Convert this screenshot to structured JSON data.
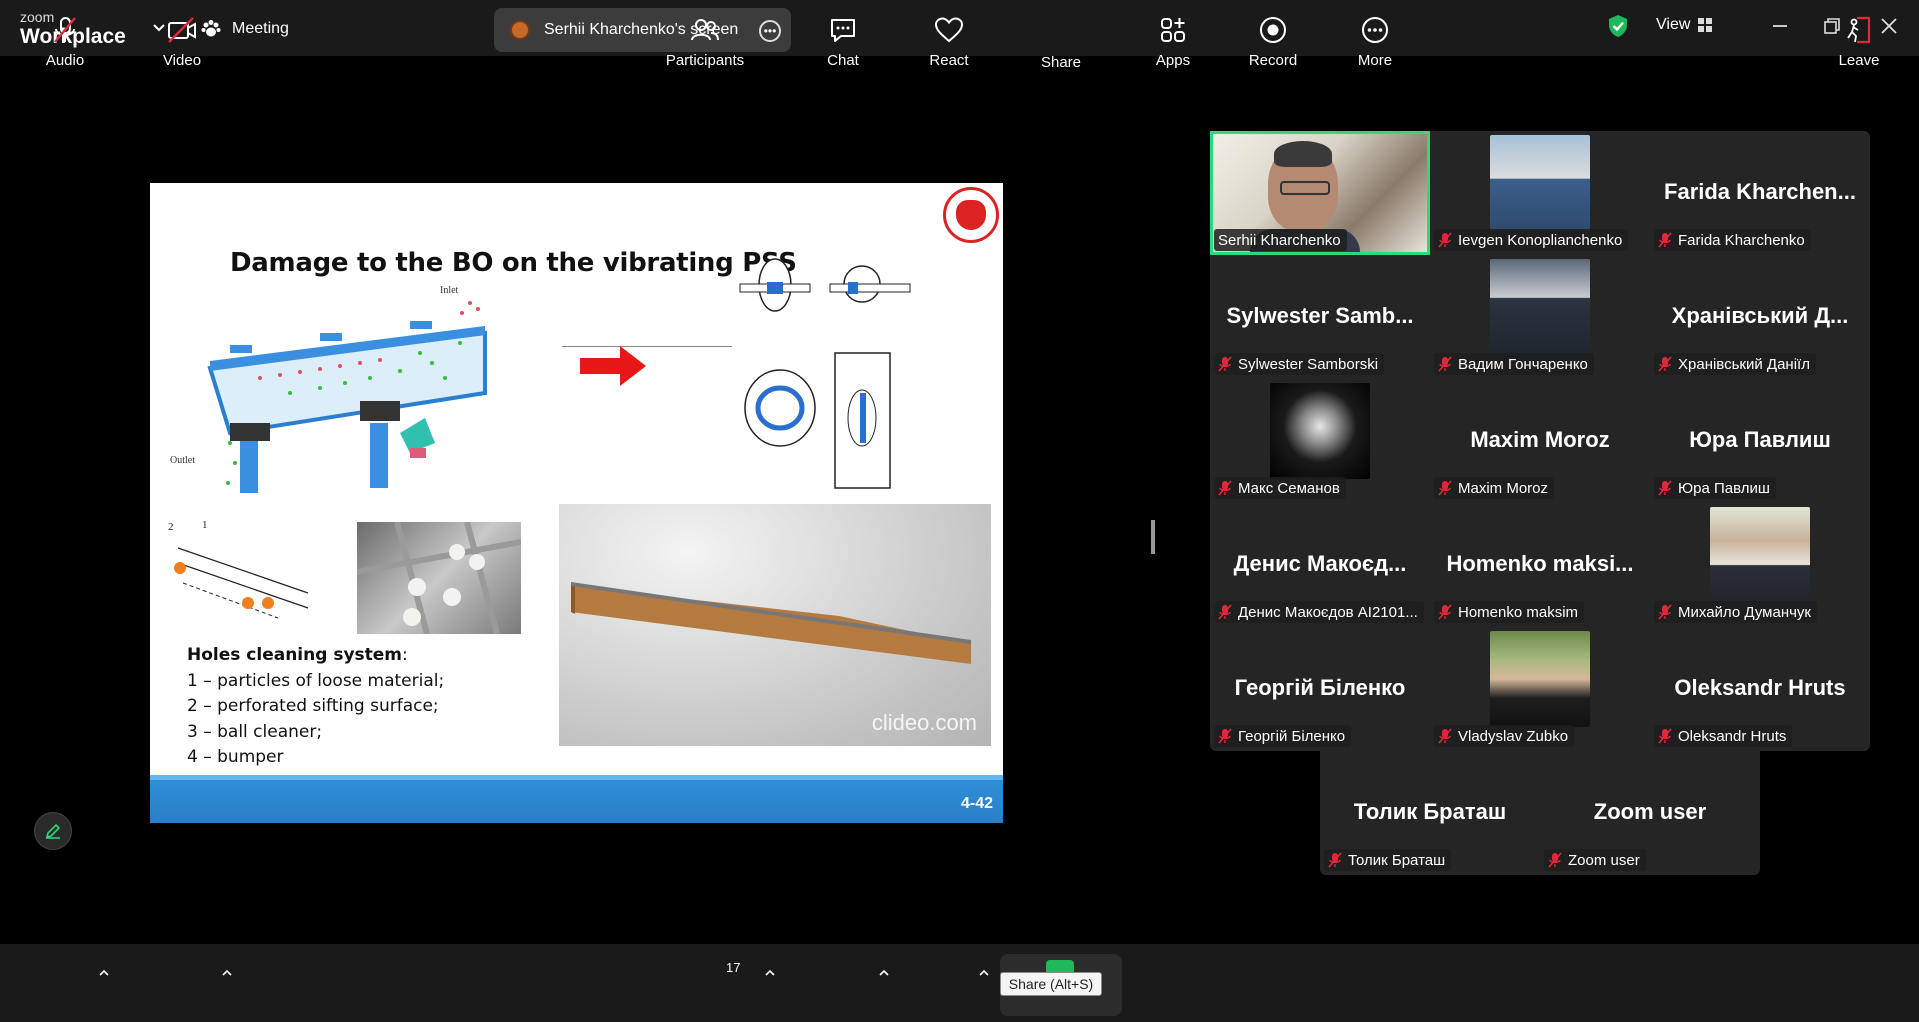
{
  "app": {
    "logo_top": "zoom",
    "logo_bottom": "Workplace"
  },
  "header": {
    "meeting_label": "Meeting",
    "screen_share_label": "Serhii Kharchenko's screen",
    "view_label": "View"
  },
  "slide": {
    "title": "Damage to the BO on the vibrating PSS",
    "inlet_label": "Inlet",
    "outlet_label": "Outlet",
    "holes_heading": "Holes cleaning system",
    "holes_colon": ":",
    "holes_items": [
      "1 – particles of loose material;",
      "2 – perforated sifting surface;",
      "3 – ball cleaner;",
      "4 – bumper"
    ],
    "video_watermark": "clideo.com",
    "page_number": "4-42"
  },
  "gallery": {
    "participants": [
      {
        "name": "Serhii Kharchenko",
        "big": "",
        "photo": true,
        "active": true,
        "muted": false
      },
      {
        "name": "Ievgen Konoplianchenko",
        "big": "",
        "photo": true,
        "muted": true
      },
      {
        "name": "Farida Kharchenko",
        "big": "Farida  Kharchen...",
        "muted": true
      },
      {
        "name": "Sylwester Samborski",
        "big": "Sylwester  Samb...",
        "muted": true
      },
      {
        "name": "Вадим Гончаренко",
        "big": "",
        "photo": true,
        "muted": true
      },
      {
        "name": "Хранівський Даніїл",
        "big": "Хранівський  Д...",
        "muted": true
      },
      {
        "name": "Макс Семанов",
        "big": "",
        "photo": true,
        "muted": true
      },
      {
        "name": "Maxim Moroz",
        "big": "Maxim Moroz",
        "muted": true
      },
      {
        "name": "Юра Павлиш",
        "big": "Юра Павлиш",
        "muted": true
      },
      {
        "name": "Денис Макоєдов АІ2101...",
        "big": "Денис  Макоєд...",
        "muted": true
      },
      {
        "name": "Homenko maksim",
        "big": "Homenko  maksi...",
        "muted": true
      },
      {
        "name": "Михайло Думанчук",
        "big": "",
        "photo": true,
        "muted": true
      },
      {
        "name": "Георгій Біленко",
        "big": "Георгій Біленко",
        "muted": true
      },
      {
        "name": "Vladyslav Zubko",
        "big": "",
        "photo": true,
        "muted": true
      },
      {
        "name": "Oleksandr Hruts",
        "big": "Oleksandr Hruts",
        "muted": true
      },
      {
        "name": "Толик Браташ",
        "big": "Толик Браташ",
        "muted": true
      },
      {
        "name": "Zoom user",
        "big": "Zoom user",
        "muted": true
      }
    ]
  },
  "toolbar": {
    "audio": "Audio",
    "video": "Video",
    "participants": "Participants",
    "participants_count": "17",
    "chat": "Chat",
    "react": "React",
    "share": "Share",
    "share_tooltip": "Share (Alt+S)",
    "apps": "Apps",
    "record": "Record",
    "more": "More",
    "leave": "Leave"
  },
  "colors": {
    "accent_green": "#2dd97b",
    "share_green": "#1fb85a",
    "leave_red": "#e0283c",
    "muted_red": "#e0283c"
  }
}
